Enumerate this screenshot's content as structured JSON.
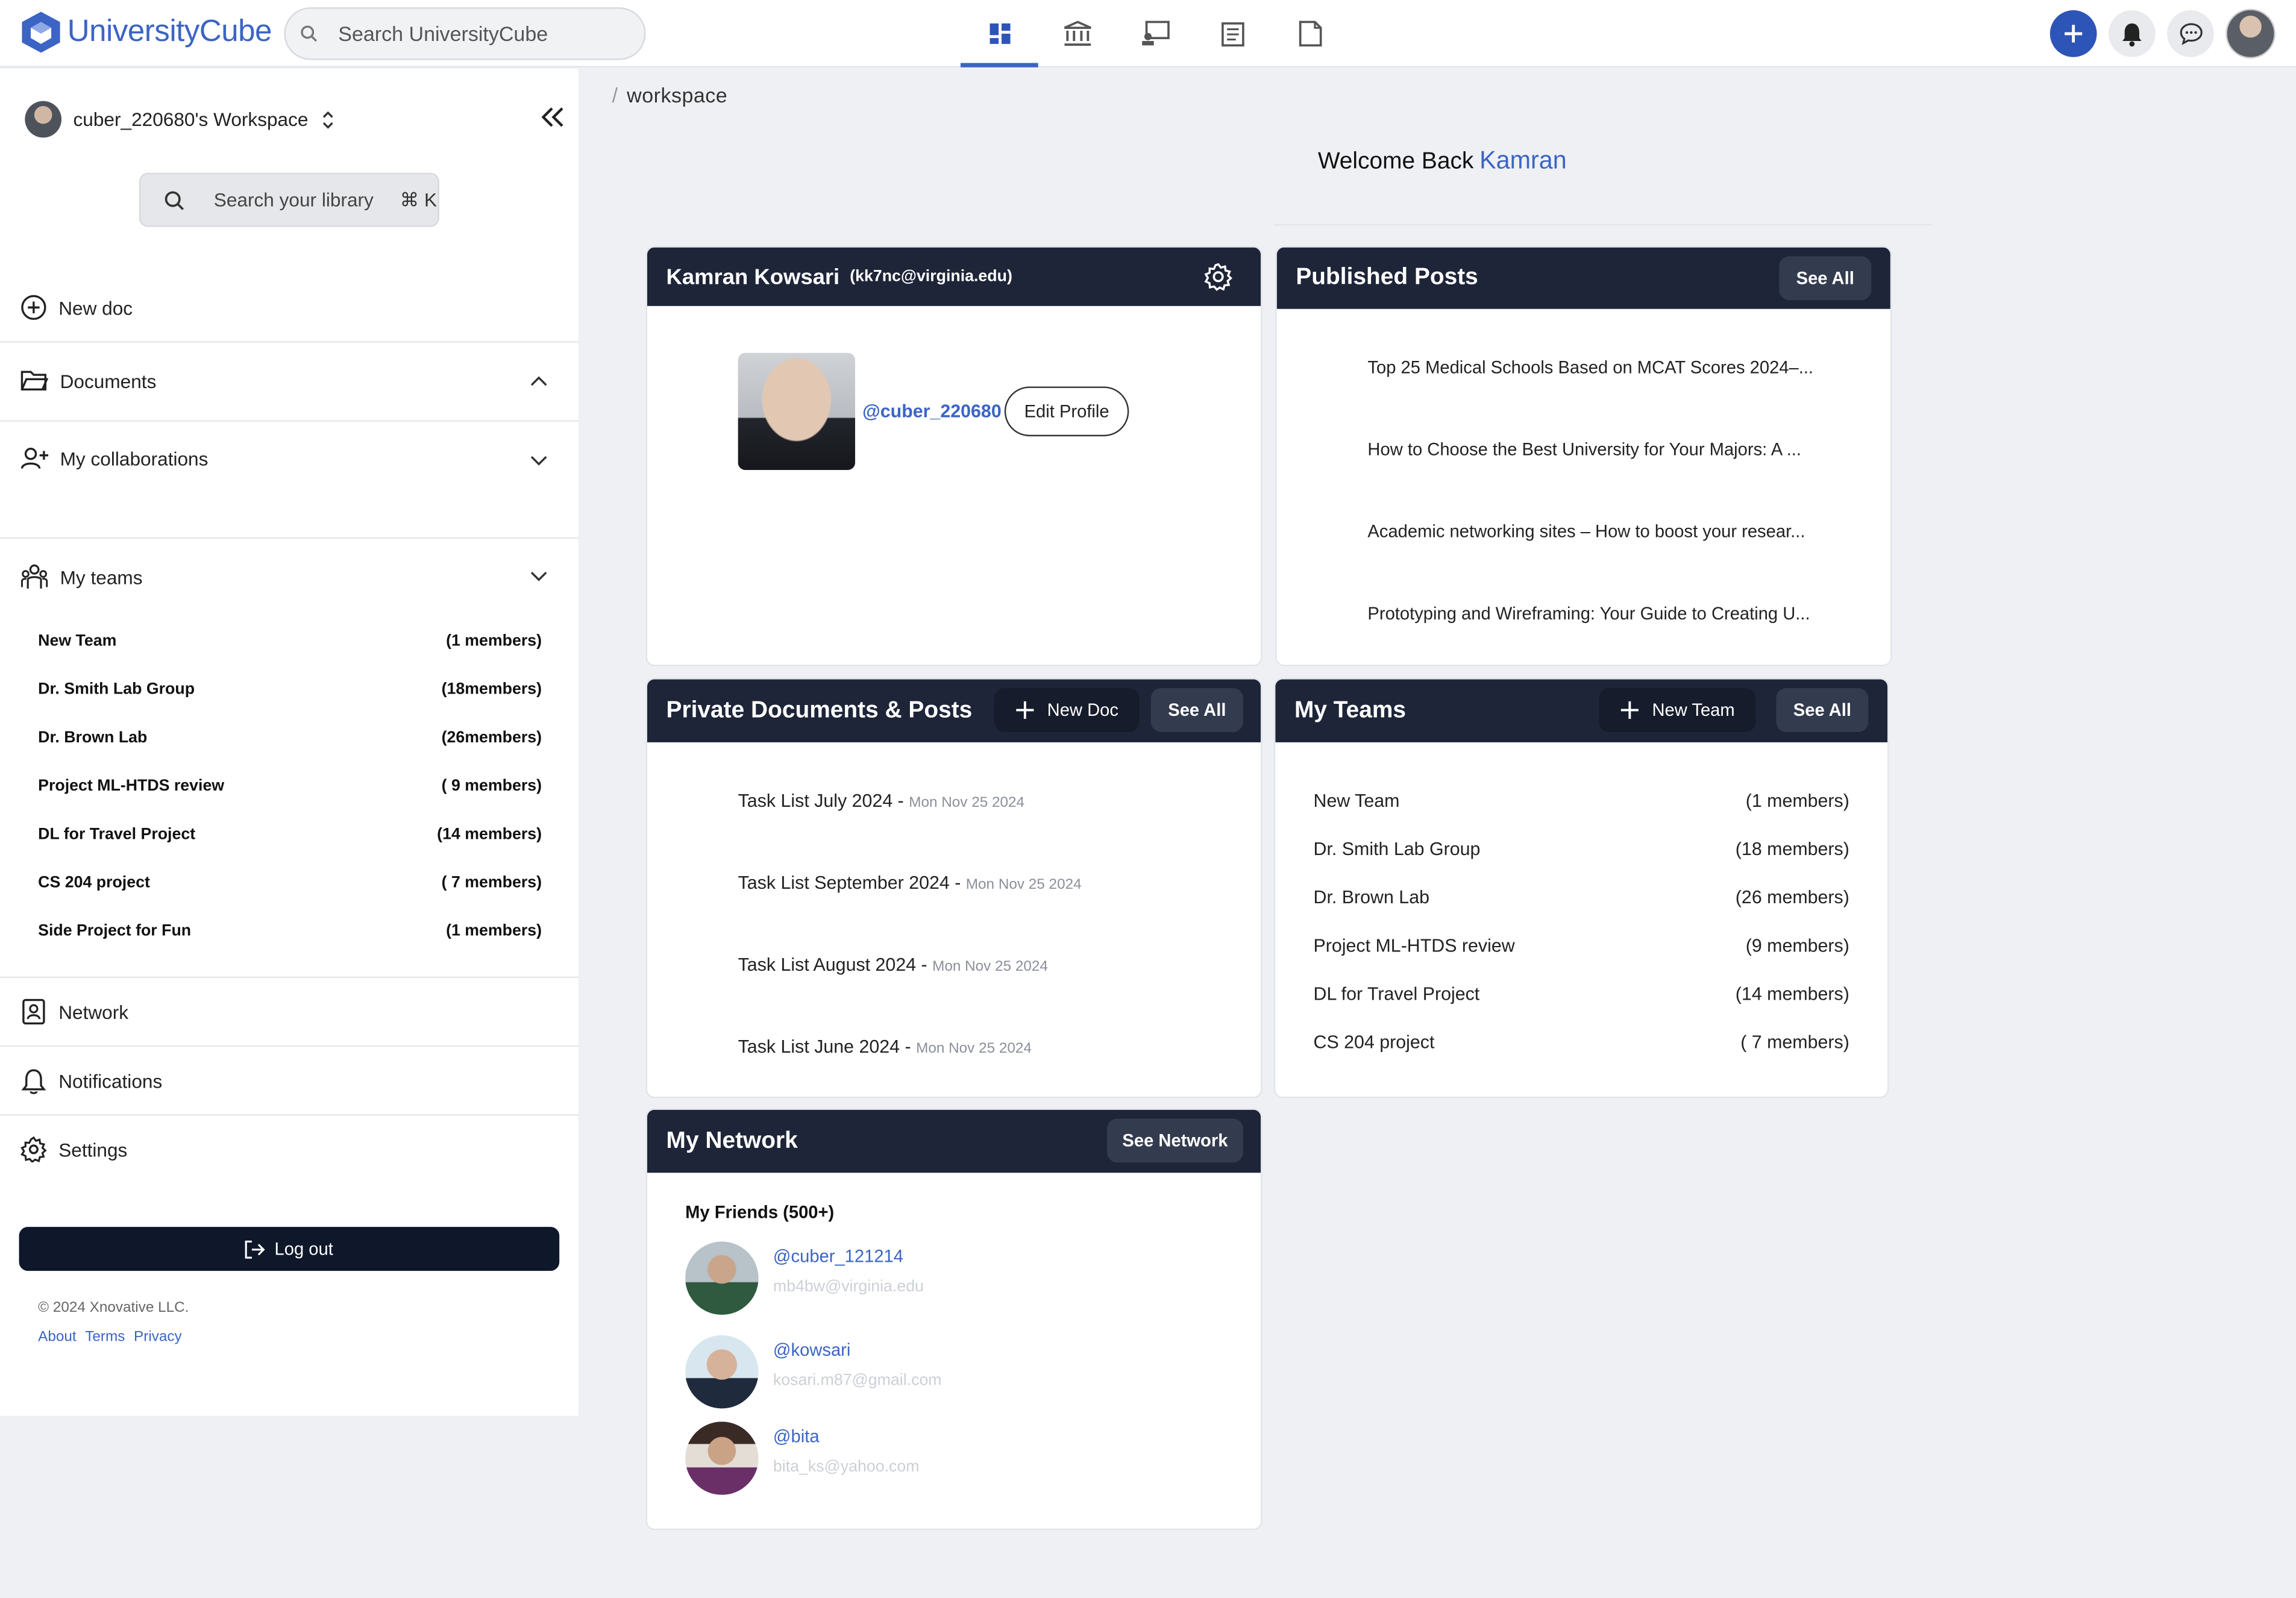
{
  "app": {
    "name": "UniversityCube",
    "search_placeholder": "Search UniversityCube"
  },
  "nav": {
    "icons": [
      "dashboard-icon",
      "institution-icon",
      "presentation-icon",
      "article-icon",
      "document-icon"
    ],
    "active": "dashboard-icon"
  },
  "colors": {
    "brand": "#3b64c5",
    "header_dark": "#1e2538",
    "logout_bg": "#0f172a"
  },
  "sidebar": {
    "workspace": "cuber_220680's Workspace",
    "search_placeholder": "Search your library",
    "search_shortcut": "⌘ K",
    "new_doc": "New doc",
    "documents": "Documents",
    "collaborations": "My collaborations",
    "teams": "My teams",
    "team_items": [
      {
        "name": "New Team",
        "members": "(1 members)"
      },
      {
        "name": "Dr. Smith Lab Group",
        "members": "(18members)"
      },
      {
        "name": "Dr. Brown Lab",
        "members": "(26members)"
      },
      {
        "name": "Project ML-HTDS review",
        "members": "( 9 members)"
      },
      {
        "name": "DL for Travel Project",
        "members": "(14 members)"
      },
      {
        "name": "CS 204 project",
        "members": "( 7 members)"
      },
      {
        "name": "Side Project for Fun",
        "members": "(1 members)"
      }
    ],
    "network": "Network",
    "notifications": "Notifications",
    "settings": "Settings",
    "logout": "Log out",
    "copyright": "© 2024 Xnovative LLC.",
    "links": [
      "About",
      "Terms",
      "Privacy"
    ]
  },
  "breadcrumb": {
    "sep": "/",
    "current": "workspace"
  },
  "welcome": {
    "text": "Welcome Back",
    "name": "Kamran"
  },
  "profile": {
    "name": "Kamran Kowsari",
    "email": "(kk7nc@virginia.edu)",
    "handle": "@cuber_220680",
    "edit_label": "Edit Profile"
  },
  "published": {
    "title": "Published Posts",
    "see_all": "See All",
    "posts": [
      "Top 25 Medical Schools Based on MCAT Scores 2024–...",
      "How to Choose the Best University for Your Majors: A ...",
      "Academic networking sites – How to boost your resear...",
      "Prototyping and Wireframing: Your Guide to Creating U..."
    ]
  },
  "private_docs": {
    "title": "Private Documents & Posts",
    "new_doc": "New Doc",
    "see_all": "See All",
    "docs": [
      {
        "name": "Task List July 2024",
        "date": "Mon Nov 25 2024"
      },
      {
        "name": "Task List September 2024",
        "date": "Mon Nov 25 2024"
      },
      {
        "name": "Task List August 2024",
        "date": "Mon Nov 25 2024"
      },
      {
        "name": "Task List June 2024",
        "date": "Mon Nov 25 2024"
      }
    ]
  },
  "my_teams": {
    "title": "My Teams",
    "new_team": "New Team",
    "see_all": "See All",
    "teams": [
      {
        "name": "New Team",
        "members": "(1 members)"
      },
      {
        "name": "Dr. Smith Lab Group",
        "members": "(18 members)"
      },
      {
        "name": "Dr. Brown Lab",
        "members": "(26 members)"
      },
      {
        "name": "Project ML-HTDS review",
        "members": "(9 members)"
      },
      {
        "name": "DL for Travel Project",
        "members": "(14 members)"
      },
      {
        "name": "CS 204 project",
        "members": "( 7 members)"
      }
    ]
  },
  "network": {
    "title": "My Network",
    "see_network": "See Network",
    "friends_label": "My Friends (500+)",
    "friends": [
      {
        "handle": "@cuber_121214",
        "email": "mb4bw@virginia.edu"
      },
      {
        "handle": "@kowsari",
        "email": "kosari.m87@gmail.com"
      },
      {
        "handle": "@bita",
        "email": "bita_ks@yahoo.com"
      }
    ]
  }
}
